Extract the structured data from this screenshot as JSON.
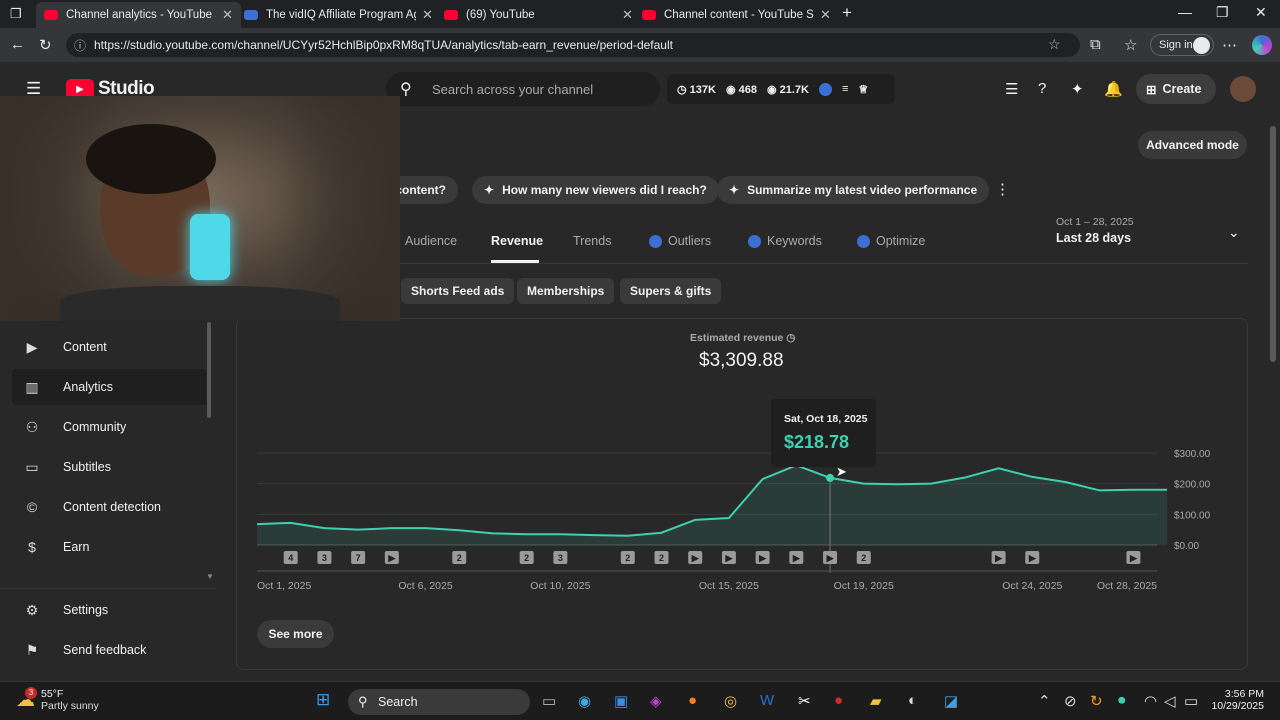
{
  "browser": {
    "tabs": [
      {
        "title": "Channel analytics - YouTube Studi",
        "color": "#ff0033",
        "active": true
      },
      {
        "title": "The vidIQ Affiliate Program Agree",
        "color": "#3b6fd6",
        "active": false
      },
      {
        "title": "(69) YouTube",
        "color": "#ff0033",
        "active": false
      },
      {
        "title": "Channel content - YouTube Studi",
        "color": "#ff0033",
        "active": false
      }
    ],
    "url": "https://studio.youtube.com/channel/UCYyr52HchlBip0pxRM8qTUA/analytics/tab-earn_revenue/period-default",
    "signin_label": "Sign in"
  },
  "header": {
    "logo_text": "Studio",
    "search_placeholder": "Search across your channel",
    "stats": [
      "137K",
      "468",
      "21.7K"
    ],
    "create_label": "Create"
  },
  "main": {
    "advanced_mode_label": "Advanced mode",
    "suggestion_chips": [
      "content?",
      "How many new viewers did I reach?",
      "Summarize my latest video performance"
    ],
    "tabs": [
      "Audience",
      "Revenue",
      "Trends",
      "Outliers",
      "Keywords",
      "Optimize"
    ],
    "date_range": "Oct 1 – 28, 2025",
    "date_label": "Last 28 days",
    "sub_chips": [
      "Shorts Feed ads",
      "Memberships",
      "Supers & gifts"
    ],
    "see_more": "See more"
  },
  "sidebar": {
    "items": [
      {
        "label": "Content",
        "icon": "content-icon"
      },
      {
        "label": "Analytics",
        "icon": "analytics-icon"
      },
      {
        "label": "Community",
        "icon": "community-icon"
      },
      {
        "label": "Subtitles",
        "icon": "subtitles-icon"
      },
      {
        "label": "Content detection",
        "icon": "copyright-icon"
      },
      {
        "label": "Earn",
        "icon": "dollar-icon"
      },
      {
        "label": "Settings",
        "icon": "gear-icon"
      },
      {
        "label": "Send feedback",
        "icon": "feedback-icon"
      }
    ]
  },
  "chart": {
    "metric_label": "Estimated revenue",
    "total": "$3,309.88",
    "tooltip_date": "Sat, Oct 18, 2025",
    "tooltip_value": "$218.78",
    "line_color": "#3fd0b0"
  },
  "chart_data": {
    "type": "area",
    "x": [
      "Oct 1, 2025",
      "Oct 2, 2025",
      "Oct 3, 2025",
      "Oct 4, 2025",
      "Oct 5, 2025",
      "Oct 6, 2025",
      "Oct 7, 2025",
      "Oct 8, 2025",
      "Oct 9, 2025",
      "Oct 10, 2025",
      "Oct 11, 2025",
      "Oct 12, 2025",
      "Oct 13, 2025",
      "Oct 14, 2025",
      "Oct 15, 2025",
      "Oct 16, 2025",
      "Oct 17, 2025",
      "Oct 18, 2025",
      "Oct 19, 2025",
      "Oct 20, 2025",
      "Oct 21, 2025",
      "Oct 22, 2025",
      "Oct 23, 2025",
      "Oct 24, 2025",
      "Oct 25, 2025",
      "Oct 26, 2025",
      "Oct 27, 2025",
      "Oct 28, 2025"
    ],
    "values": [
      68,
      72,
      55,
      50,
      55,
      55,
      48,
      38,
      35,
      35,
      32,
      30,
      40,
      82,
      88,
      215,
      260,
      218.78,
      200,
      198,
      200,
      220,
      250,
      222,
      205,
      178,
      180,
      180
    ],
    "x_tick_labels": [
      "Oct 1, 2025",
      "Oct 6, 2025",
      "Oct 10, 2025",
      "Oct 15, 2025",
      "Oct 19, 2025",
      "Oct 24, 2025",
      "Oct 28, 2025"
    ],
    "y_tick_labels": [
      "$300.00",
      "$200.00",
      "$100.00",
      "$0.00"
    ],
    "ylim": [
      0,
      300
    ],
    "grid": true,
    "markers": [
      {
        "date": "Oct 2, 2025",
        "label": "4"
      },
      {
        "date": "Oct 3, 2025",
        "label": "3"
      },
      {
        "date": "Oct 4, 2025",
        "label": "7"
      },
      {
        "date": "Oct 5, 2025",
        "label": "▶"
      },
      {
        "date": "Oct 7, 2025",
        "label": "2"
      },
      {
        "date": "Oct 9, 2025",
        "label": "2"
      },
      {
        "date": "Oct 10, 2025",
        "label": "3"
      },
      {
        "date": "Oct 12, 2025",
        "label": "2"
      },
      {
        "date": "Oct 13, 2025",
        "label": "2"
      },
      {
        "date": "Oct 14, 2025",
        "label": "▶"
      },
      {
        "date": "Oct 15, 2025",
        "label": "▶"
      },
      {
        "date": "Oct 16, 2025",
        "label": "▶"
      },
      {
        "date": "Oct 17, 2025",
        "label": "▶"
      },
      {
        "date": "Oct 18, 2025",
        "label": "▶"
      },
      {
        "date": "Oct 19, 2025",
        "label": "2"
      },
      {
        "date": "Oct 23, 2025",
        "label": "▶"
      },
      {
        "date": "Oct 24, 2025",
        "label": "▶"
      },
      {
        "date": "Oct 27, 2025",
        "label": "▶"
      }
    ]
  },
  "taskbar": {
    "weather_temp": "55°F",
    "weather_desc": "Partly sunny",
    "weather_badge": "3",
    "search_label": "Search",
    "time": "3:56 PM",
    "date": "10/29/2025"
  }
}
